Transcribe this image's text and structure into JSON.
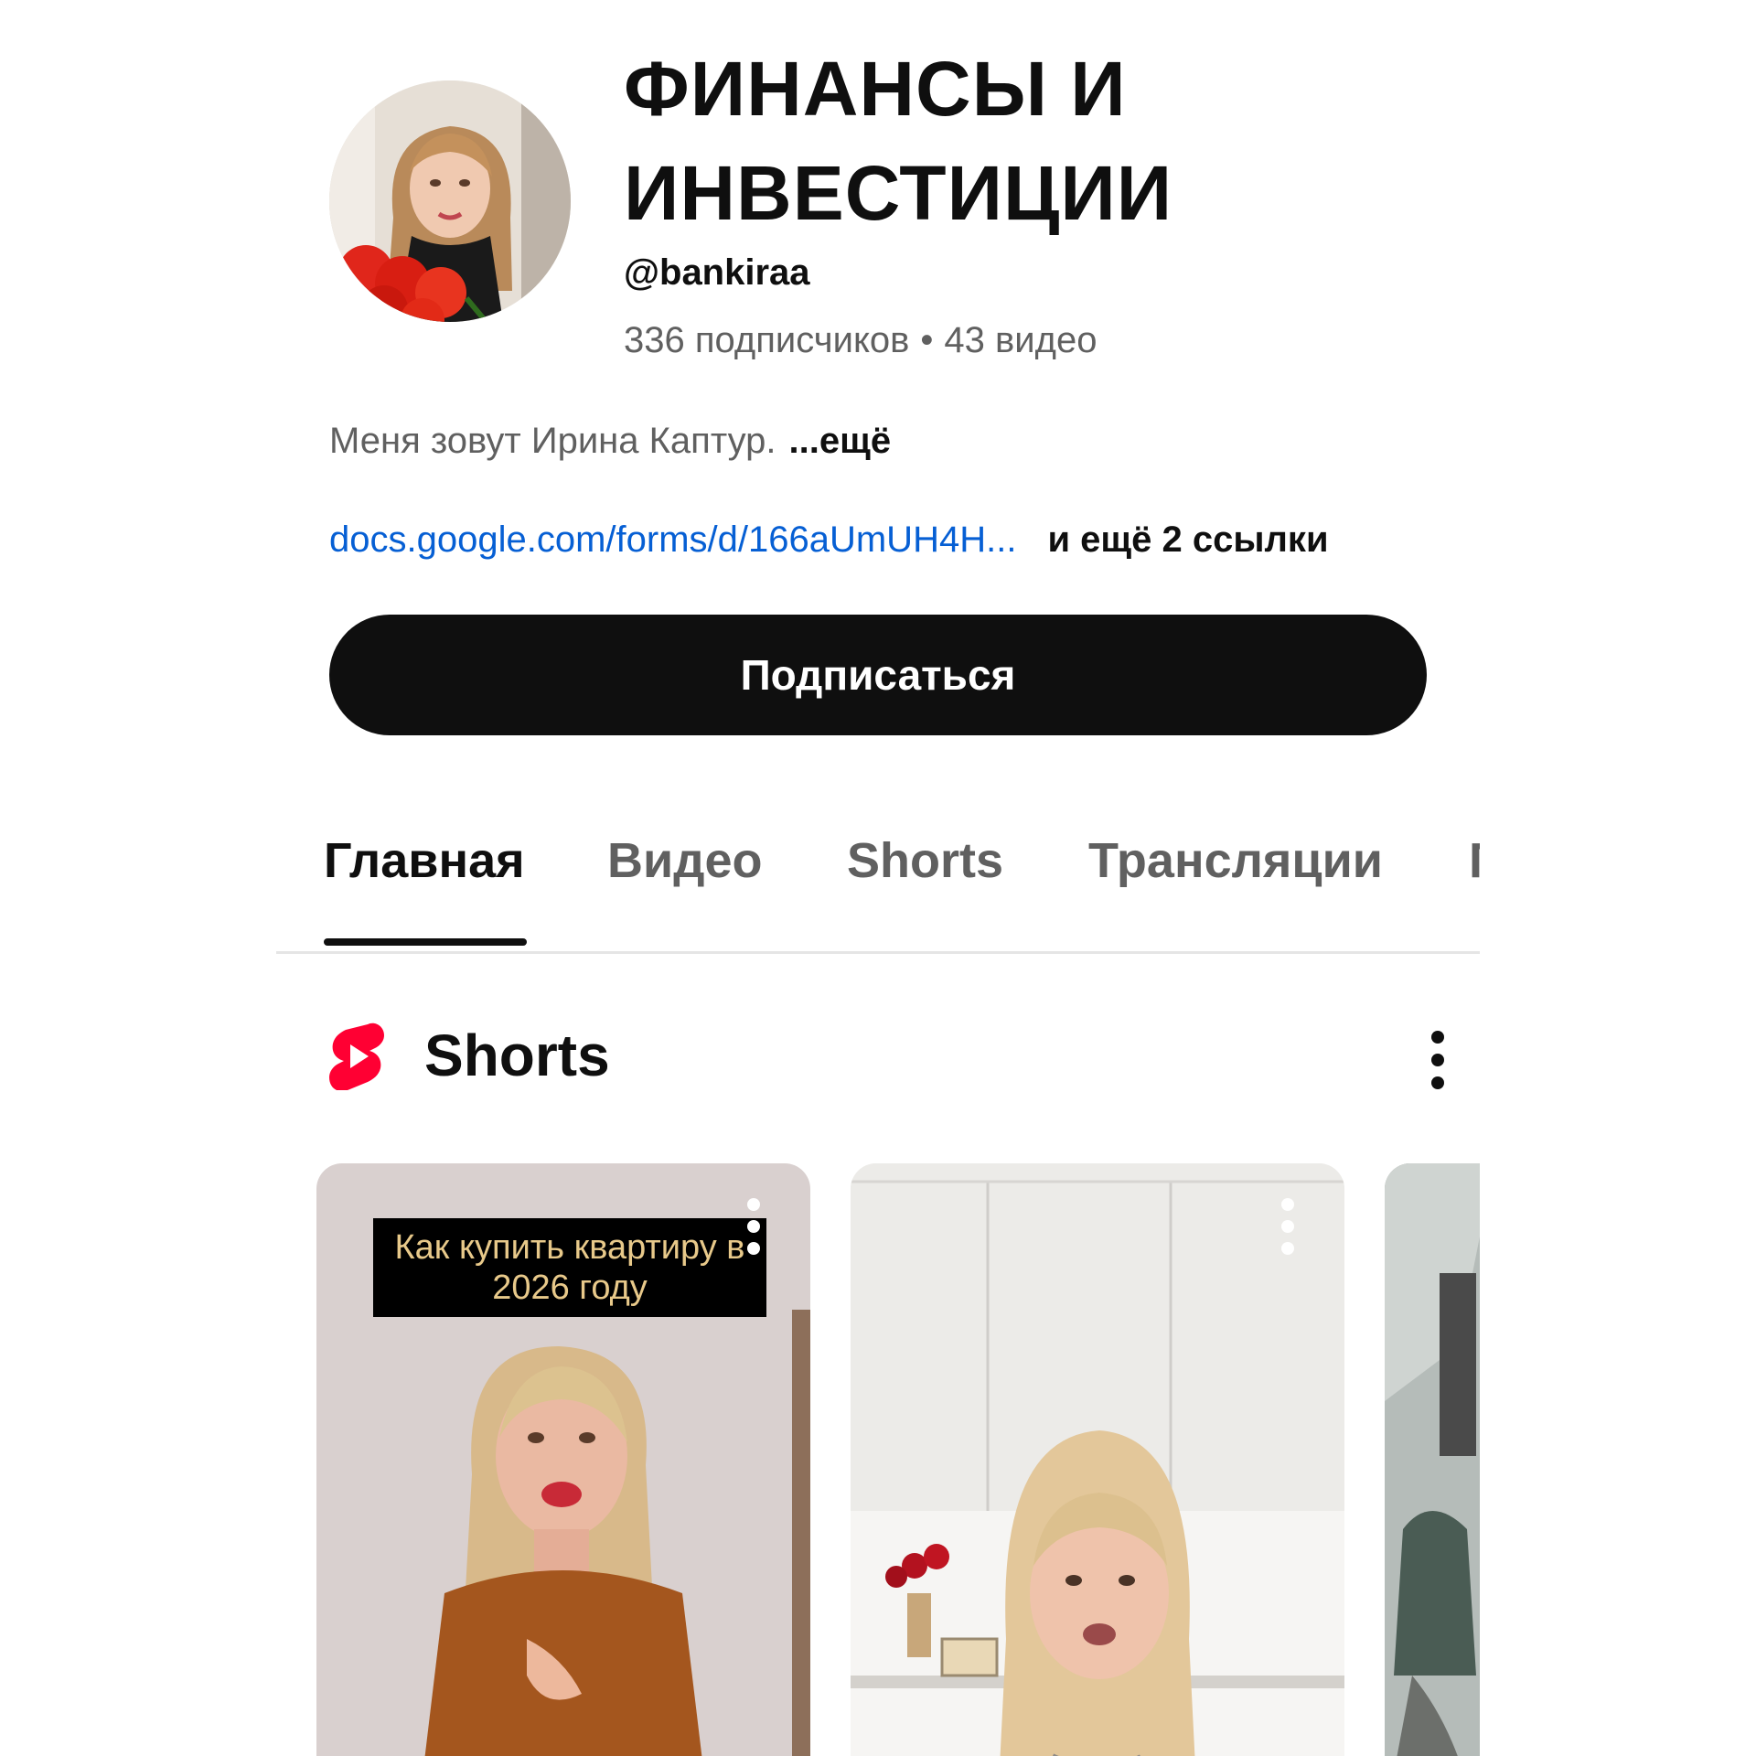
{
  "channel": {
    "title": "ФИНАНСЫ И ИНВЕСТИЦИИ",
    "handle": "@bankiraa",
    "subscribers": "336 подписчиков",
    "separator": "•",
    "videos": "43 видео",
    "description": "Меня зовут Ирина Каптур.",
    "description_more": "...ещё",
    "link": "docs.google.com/forms/d/166aUmUH4H...",
    "more_links": "и ещё 2 ссылки",
    "subscribe_label": "Подписаться"
  },
  "tabs": [
    {
      "label": "Главная",
      "active": true
    },
    {
      "label": "Видео",
      "active": false
    },
    {
      "label": "Shorts",
      "active": false
    },
    {
      "label": "Трансляции",
      "active": false
    },
    {
      "label": "Плейлисты",
      "active": false
    }
  ],
  "shorts_section": {
    "title": "Shorts",
    "icon": "shorts-logo-icon",
    "accent": "#ff0033"
  },
  "shorts": [
    {
      "caption": "Как купить квартиру в 2026 году"
    },
    {
      "caption": ""
    },
    {
      "caption": ""
    }
  ],
  "colors": {
    "text_primary": "#0f0f0f",
    "text_secondary": "#606060",
    "link": "#065fd4",
    "button_bg": "#0f0f0f"
  }
}
